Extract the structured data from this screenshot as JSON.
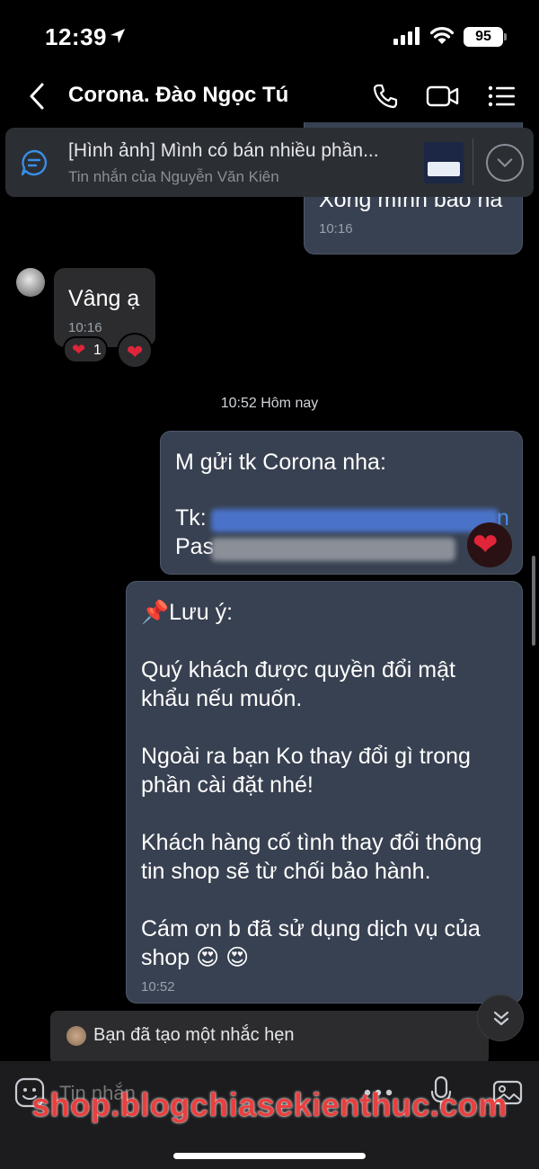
{
  "status": {
    "time": "12:39",
    "battery": "95"
  },
  "header": {
    "title": "Corona. Đào Ngọc Tú",
    "back_icon": "chevron-left-icon",
    "call_icon": "phone-icon",
    "video_icon": "video-camera-icon",
    "menu_icon": "list-menu-icon"
  },
  "pinned": {
    "text": "[Hình ảnh] Mình có bán nhiều phần...",
    "sub": "Tin nhắn của Nguyễn Văn Kiên"
  },
  "messages": {
    "m1": {
      "text": "Xong mình báo ha",
      "time": "10:16"
    },
    "m2": {
      "text": "Vâng ạ",
      "time": "10:16",
      "reaction": "❤️",
      "reaction_count": "1"
    },
    "separator": "10:52 Hôm nay",
    "m3": {
      "line1": "M gửi tk Corona nha:",
      "tk_label": "Tk:",
      "pass_label": "Pas",
      "tk_tail": "n"
    },
    "m4": {
      "text": "📌Lưu ý:\n\nQuý khách được quyền đổi mật\nkhẩu nếu muốn.\n\nNgoài ra bạn Ko thay đổi gì trong\nphần cài đặt nhé!\n\nKhách hàng cố tình thay đổi thông\ntin shop sẽ từ chối bảo hành.\n\nCám ơn b đã sử dụng dịch vụ của\nshop 😍 😍",
      "time": "10:52"
    }
  },
  "reminder": {
    "text": "Bạn đã tạo một nhắc hẹn"
  },
  "input": {
    "placeholder": "Tin nhắn"
  },
  "watermark": "shop.blogchiasekienthuc.com",
  "colors": {
    "outgoing_bubble": "#384151",
    "incoming_bubble": "#2c2c2e",
    "background": "#000000",
    "reaction_heart": "#e0243a",
    "watermark": "#e8403f"
  }
}
